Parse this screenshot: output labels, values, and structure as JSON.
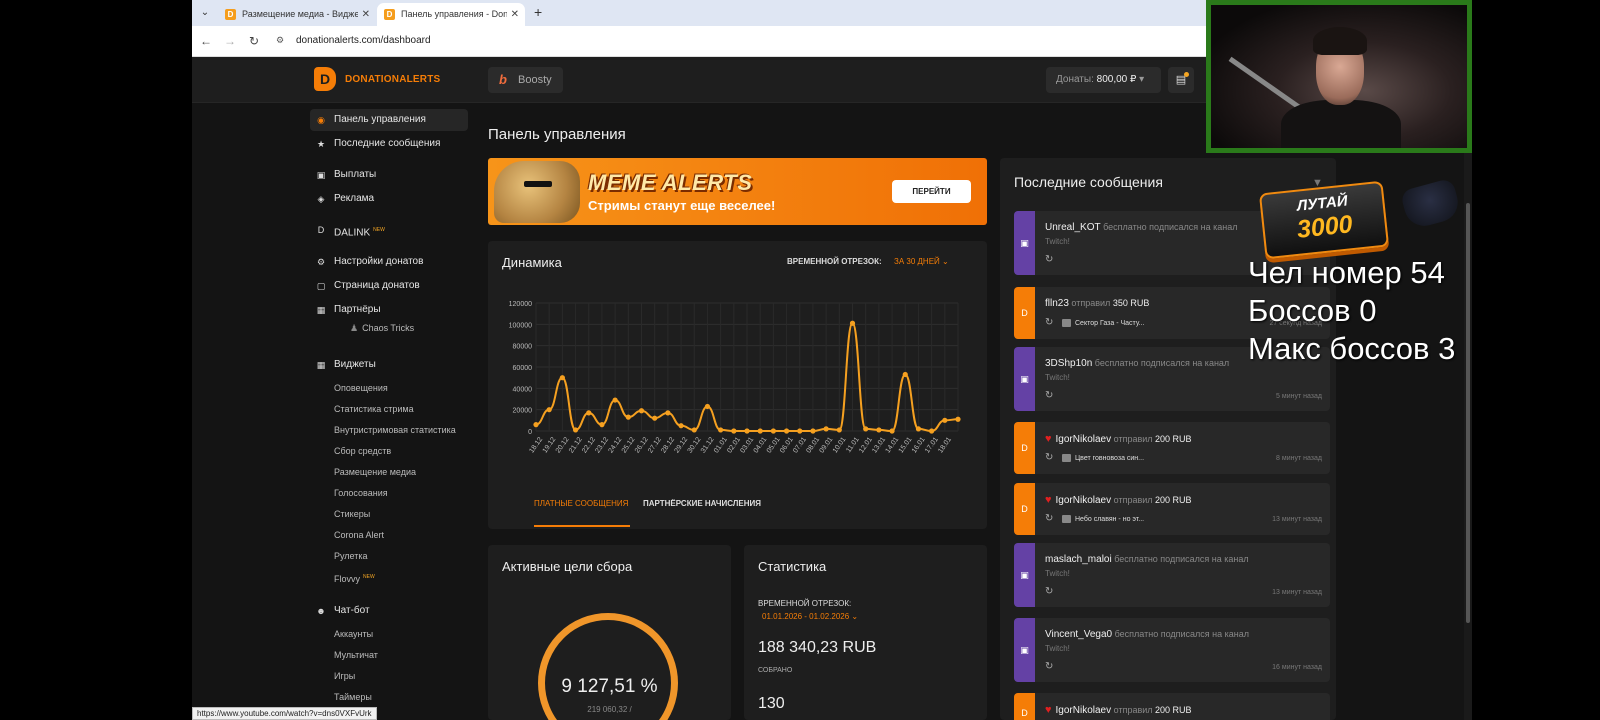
{
  "browser": {
    "tabs": [
      {
        "title": "Размещение медиа - Виджеты",
        "active": false
      },
      {
        "title": "Панель управления - DonationAlerts",
        "active": true
      }
    ],
    "new_tab": "+",
    "url": "donationalerts.com/dashboard",
    "status_url": "https://www.youtube.com/watch?v=dns0VXFvUrk"
  },
  "header": {
    "logo": "DONATIONALERTS",
    "boosty": "Boosty",
    "donates_label": "Донаты:",
    "donates_value": "800,00 ₽",
    "accent": "#f57d07"
  },
  "sidebar": {
    "items": [
      {
        "label": "Панель управления",
        "icon": "dashboard-icon",
        "active": true
      },
      {
        "label": "Последние сообщения",
        "icon": "star-icon"
      },
      {
        "label": "Выплаты",
        "icon": "wallet-icon"
      },
      {
        "label": "Реклама",
        "icon": "ad-icon"
      },
      {
        "label": "DALINK",
        "icon": "dalink-icon",
        "badge": "NEW"
      },
      {
        "label": "Настройки донатов",
        "icon": "gear-icon"
      },
      {
        "label": "Страница донатов",
        "icon": "page-icon"
      },
      {
        "label": "Партнёры",
        "icon": "partners-icon"
      },
      {
        "label": "Виджеты",
        "icon": "widgets-icon"
      },
      {
        "label": "Чат-бот",
        "icon": "chatbot-icon"
      }
    ],
    "partner_sub": "Chaos Tricks",
    "widgets_sub": [
      "Оповещения",
      "Статистика стрима",
      "Внутристримовая статистика",
      "Сбор средств",
      "Размещение медиа",
      "Голосования",
      "Стикеры",
      "Corona Alert",
      "Рулетка",
      "Flovvy"
    ],
    "flovvy_badge": "NEW",
    "chatbot_sub": [
      "Аккаунты",
      "Мультичат",
      "Игры",
      "Таймеры"
    ]
  },
  "main": {
    "title": "Панель управления",
    "banner": {
      "title": "MEME ALERTS",
      "subtitle": "Стримы станут еще веселее!",
      "button": "ПЕРЕЙТИ"
    },
    "dynamics": {
      "title": "Динамика",
      "period_label": "ВРЕМЕННОЙ ОТРЕЗОК:",
      "period_value": "ЗА 30 ДНЕЙ ⌄",
      "tab_paid": "ПЛАТНЫЕ СООБЩЕНИЯ",
      "tab_partner": "ПАРТНЁРСКИЕ НАЧИСЛЕНИЯ"
    },
    "goals": {
      "title": "Активные цели сбора",
      "percent": "9 127,51 %",
      "sub": "219 060,32 /"
    },
    "stats": {
      "title": "Статистика",
      "period_label": "ВРЕМЕННОЙ ОТРЕЗОК:",
      "period_value": "01.01.2026 - 01.02.2026 ⌄",
      "amount": "188 340,23 RUB",
      "amount_label": "СОБРАНО",
      "count": "130"
    }
  },
  "chart_data": {
    "type": "line",
    "title": "Динамика",
    "categories": [
      "18.12",
      "19.12",
      "20.12",
      "21.12",
      "22.12",
      "23.12",
      "24.12",
      "25.12",
      "26.12",
      "27.12",
      "28.12",
      "29.12",
      "30.12",
      "31.12",
      "01.01",
      "02.01",
      "03.01",
      "04.01",
      "05.01",
      "06.01",
      "07.01",
      "08.01",
      "09.01",
      "10.01",
      "11.01",
      "12.01",
      "13.01",
      "14.01",
      "15.01",
      "16.01",
      "17.01",
      "18.01"
    ],
    "values": [
      6000,
      20000,
      50000,
      1000,
      17000,
      6000,
      29000,
      13000,
      19000,
      12000,
      17000,
      5000,
      1000,
      23000,
      1000,
      0,
      0,
      0,
      0,
      0,
      0,
      0,
      2000,
      1000,
      101000,
      2000,
      1000,
      0,
      53000,
      2000,
      0,
      10000,
      11000
    ],
    "yticks": [
      0,
      20000,
      40000,
      60000,
      80000,
      100000,
      120000
    ],
    "ylim": [
      0,
      120000
    ],
    "grid": true,
    "color": "#f5a020"
  },
  "messages": {
    "title": "Последние сообщения",
    "items": [
      {
        "name": "Unreal_KOT",
        "action": "бесплатно подписался на канал",
        "sub": "Twitch!",
        "media": "",
        "time": "",
        "source": "twitch"
      },
      {
        "name": "flln23",
        "action": "отправил",
        "amount": "350 RUB",
        "sub": "",
        "media": "Сектор Газа - Часту...",
        "time": "27 секунд назад",
        "source": "da"
      },
      {
        "name": "3DShp10n",
        "action": "бесплатно подписался на канал",
        "sub": "Twitch!",
        "media": "",
        "time": "5 минут назад",
        "source": "twitch"
      },
      {
        "name": "IgorNikolaev",
        "action": "отправил",
        "amount": "200 RUB",
        "sub": "",
        "media": "Цвет говновоза син...",
        "time": "8 минут назад",
        "source": "da",
        "heart": true
      },
      {
        "name": "IgorNikolaev",
        "action": "отправил",
        "amount": "200 RUB",
        "sub": "",
        "media": "Небо славян - но эт...",
        "time": "13 минут назад",
        "source": "da",
        "heart": true
      },
      {
        "name": "maslach_maloi",
        "action": "бесплатно подписался на канал",
        "sub": "Twitch!",
        "media": "",
        "time": "13 минут назад",
        "source": "twitch"
      },
      {
        "name": "Vincent_Vega0",
        "action": "бесплатно подписался на канал",
        "sub": "Twitch!",
        "media": "",
        "time": "16 минут назад",
        "source": "twitch"
      },
      {
        "name": "IgorNikolaev",
        "action": "отправил",
        "amount": "200 RUB",
        "sub": "",
        "media": "",
        "time": "",
        "source": "da",
        "heart": true
      }
    ]
  },
  "overlay": {
    "badge_line1": "ЛУТАЙ",
    "badge_line2": "3000",
    "lines": [
      "Чел номер 54",
      "Боссов 0",
      "Макс боссов 3"
    ]
  }
}
